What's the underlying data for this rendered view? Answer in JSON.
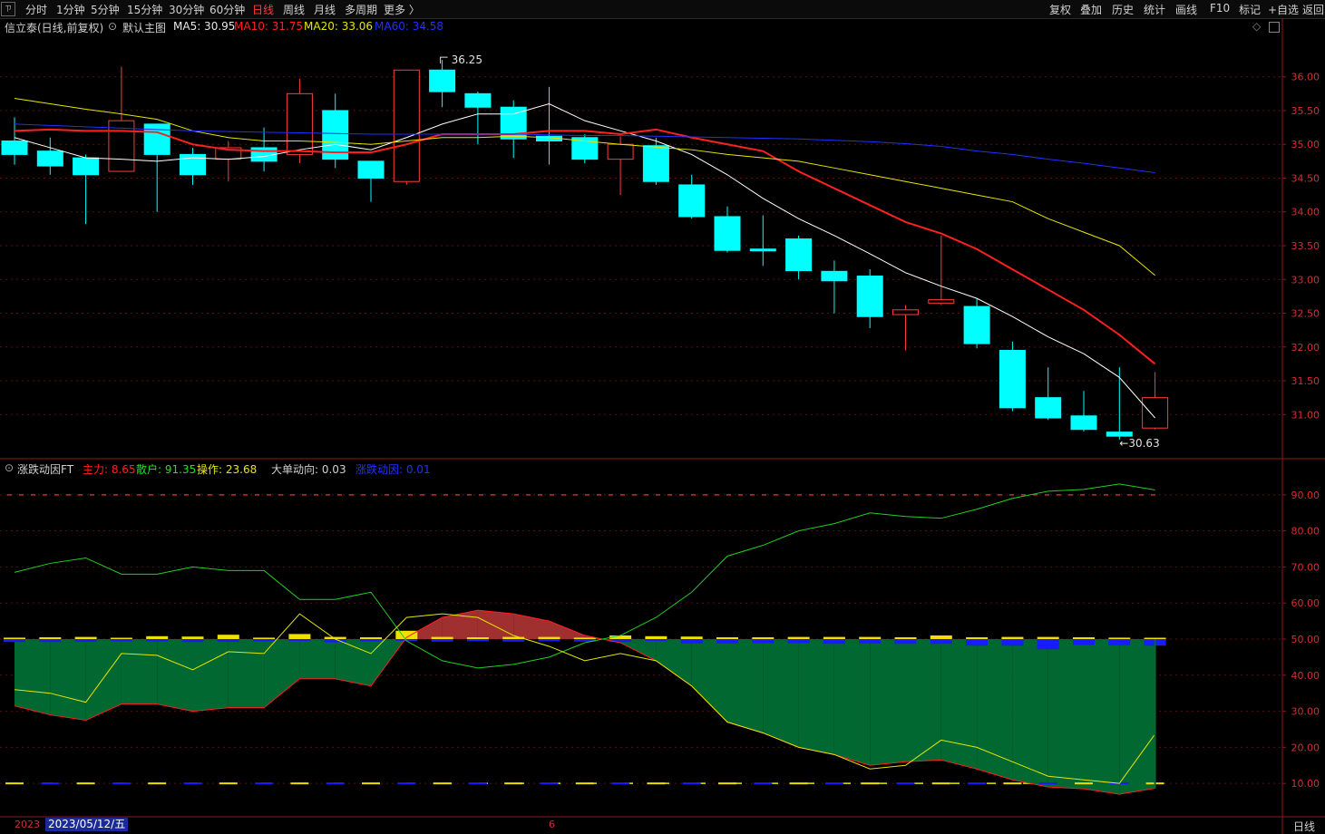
{
  "toolbar": {
    "logo": "ㄗ",
    "periods": [
      "分时",
      "1分钟",
      "5分钟",
      "15分钟",
      "30分钟",
      "60分钟",
      "日线",
      "周线",
      "月线",
      "多周期",
      "更多 〉"
    ],
    "active_period": "日线",
    "right_buttons": [
      "复权",
      "叠加",
      "历史",
      "统计",
      "画线",
      "F10",
      "标记",
      "+自选",
      "返回"
    ]
  },
  "main_chart": {
    "stock_name": "信立泰(日线,前复权)",
    "template": "默认主图",
    "ma5_label": "MA5: 30.95",
    "ma10_label": "MA10: 31.75",
    "ma20_label": "MA20: 33.06",
    "ma60_label": "MA60: 34.58",
    "high_marker": "36.25",
    "low_marker": "30.63",
    "colors": {
      "ma5": "#ffffff",
      "ma10": "#ff2020",
      "ma20": "#e6e600",
      "ma60": "#2030ff",
      "up": "#ff3b3b",
      "down": "#00ffff"
    }
  },
  "sub_chart": {
    "indicator_name": "涨跌动因FT",
    "zhuli_label": "主力: 8.65",
    "sanhu_label": "散户: 91.35",
    "caozuo_label": "操作: 23.68",
    "dadan_label": "大单动向: 0.03",
    "zhangdie_label": "涨跌动因: 0.01"
  },
  "footer": {
    "date_prefix": "2023",
    "cursor_date": "2023/05/12/五",
    "month_mark": "6",
    "period": "日线"
  },
  "chart_data": [
    {
      "type": "candlestick",
      "title": "信立泰(日线,前复权)",
      "y_ticks": [
        "36.00",
        "35.50",
        "35.00",
        "34.50",
        "34.00",
        "33.50",
        "33.00",
        "32.50",
        "32.00",
        "31.50",
        "31.00"
      ],
      "ylim": [
        30.4,
        36.6
      ],
      "candles": [
        {
          "o": 35.05,
          "c": 34.85,
          "h": 35.4,
          "l": 34.7
        },
        {
          "o": 34.9,
          "c": 34.68,
          "h": 35.1,
          "l": 34.55
        },
        {
          "o": 34.8,
          "c": 34.55,
          "h": 34.85,
          "l": 33.82
        },
        {
          "o": 34.6,
          "c": 35.35,
          "h": 36.15,
          "l": 34.6
        },
        {
          "o": 35.3,
          "c": 34.85,
          "h": 35.3,
          "l": 34.0
        },
        {
          "o": 34.85,
          "c": 34.55,
          "h": 34.95,
          "l": 34.4
        },
        {
          "o": 34.78,
          "c": 34.95,
          "h": 35.05,
          "l": 34.45
        },
        {
          "o": 34.95,
          "c": 34.75,
          "h": 35.25,
          "l": 34.6
        },
        {
          "o": 34.85,
          "c": 35.75,
          "h": 35.97,
          "l": 34.72
        },
        {
          "o": 35.5,
          "c": 34.78,
          "h": 35.75,
          "l": 34.65
        },
        {
          "o": 34.75,
          "c": 34.5,
          "h": 34.75,
          "l": 34.15
        },
        {
          "o": 34.45,
          "c": 36.1,
          "h": 36.1,
          "l": 34.4
        },
        {
          "o": 36.1,
          "c": 35.78,
          "h": 36.25,
          "l": 35.55
        },
        {
          "o": 35.75,
          "c": 35.55,
          "h": 35.78,
          "l": 35.0
        },
        {
          "o": 35.55,
          "c": 35.08,
          "h": 35.65,
          "l": 34.8
        },
        {
          "o": 35.12,
          "c": 35.05,
          "h": 35.85,
          "l": 34.7
        },
        {
          "o": 35.1,
          "c": 34.78,
          "h": 35.15,
          "l": 34.72
        },
        {
          "o": 34.78,
          "c": 35.0,
          "h": 35.12,
          "l": 34.25
        },
        {
          "o": 34.98,
          "c": 34.45,
          "h": 35.1,
          "l": 34.4
        },
        {
          "o": 34.4,
          "c": 33.93,
          "h": 34.55,
          "l": 33.9
        },
        {
          "o": 33.93,
          "c": 33.43,
          "h": 34.08,
          "l": 33.4
        },
        {
          "o": 33.45,
          "c": 33.43,
          "h": 33.95,
          "l": 33.2
        },
        {
          "o": 33.6,
          "c": 33.13,
          "h": 33.65,
          "l": 33.0
        },
        {
          "o": 33.12,
          "c": 32.98,
          "h": 33.28,
          "l": 32.5
        },
        {
          "o": 33.05,
          "c": 32.45,
          "h": 33.15,
          "l": 32.28
        },
        {
          "o": 32.48,
          "c": 32.55,
          "h": 32.62,
          "l": 31.95
        },
        {
          "o": 32.65,
          "c": 32.7,
          "h": 33.65,
          "l": 32.62
        },
        {
          "o": 32.6,
          "c": 32.05,
          "h": 32.72,
          "l": 31.98
        },
        {
          "o": 31.95,
          "c": 31.1,
          "h": 32.08,
          "l": 31.05
        },
        {
          "o": 31.25,
          "c": 30.95,
          "h": 31.7,
          "l": 30.92
        },
        {
          "o": 30.98,
          "c": 30.78,
          "h": 31.35,
          "l": 30.75
        },
        {
          "o": 30.74,
          "c": 30.68,
          "h": 31.7,
          "l": 30.63
        },
        {
          "o": 30.8,
          "c": 31.25,
          "h": 31.63,
          "l": 30.78
        }
      ],
      "ma5": [
        35.1,
        34.95,
        34.8,
        34.78,
        34.75,
        34.8,
        34.78,
        34.82,
        34.92,
        35.0,
        34.92,
        35.1,
        35.3,
        35.45,
        35.45,
        35.6,
        35.35,
        35.2,
        35.05,
        34.85,
        34.55,
        34.2,
        33.9,
        33.65,
        33.38,
        33.1,
        32.9,
        32.72,
        32.45,
        32.15,
        31.9,
        31.55,
        30.95
      ],
      "ma10": [
        35.2,
        35.22,
        35.2,
        35.2,
        35.18,
        35.0,
        34.92,
        34.9,
        34.9,
        34.88,
        34.88,
        35.0,
        35.15,
        35.15,
        35.15,
        35.2,
        35.2,
        35.15,
        35.22,
        35.1,
        35.0,
        34.9,
        34.6,
        34.35,
        34.1,
        33.85,
        33.68,
        33.45,
        33.15,
        32.85,
        32.55,
        32.18,
        31.75
      ],
      "ma20": [
        35.68,
        35.6,
        35.52,
        35.45,
        35.37,
        35.2,
        35.1,
        35.05,
        35.05,
        35.03,
        35.0,
        35.05,
        35.1,
        35.1,
        35.12,
        35.1,
        35.05,
        35.0,
        34.96,
        34.92,
        34.85,
        34.8,
        34.75,
        34.65,
        34.55,
        34.45,
        34.35,
        34.25,
        34.15,
        33.9,
        33.7,
        33.5,
        33.06
      ],
      "ma60": [
        35.3,
        35.28,
        35.26,
        35.24,
        35.22,
        35.2,
        35.19,
        35.18,
        35.17,
        35.16,
        35.15,
        35.15,
        35.15,
        35.15,
        35.15,
        35.14,
        35.13,
        35.13,
        35.12,
        35.11,
        35.1,
        35.09,
        35.08,
        35.06,
        35.04,
        35.01,
        34.97,
        34.9,
        34.85,
        34.78,
        34.72,
        34.65,
        34.58
      ]
    },
    {
      "type": "line",
      "title": "涨跌动因FT",
      "y_ticks": [
        "90.00",
        "80.00",
        "70.00",
        "60.00",
        "50.00",
        "40.00",
        "30.00",
        "20.00",
        "10.00"
      ],
      "ylim": [
        1,
        99
      ],
      "series": [
        {
          "name": "主力",
          "values": [
            31.5,
            29,
            27.5,
            32,
            32,
            30,
            31,
            31,
            39,
            39,
            37,
            50.5,
            56,
            58,
            57,
            55,
            51,
            49,
            44,
            37,
            27,
            24,
            20,
            18,
            15,
            16,
            16.5,
            14,
            11,
            9,
            8.5,
            7,
            8.65
          ]
        },
        {
          "name": "散户",
          "values": [
            68.5,
            71,
            72.5,
            68,
            68,
            70,
            69,
            69,
            61,
            61,
            63,
            49.5,
            44,
            42,
            43,
            45,
            49,
            51,
            56,
            63,
            73,
            76,
            80,
            82,
            85,
            84,
            83.5,
            86,
            89,
            91,
            91.5,
            93,
            91.35
          ]
        },
        {
          "name": "操作",
          "values": [
            36,
            35,
            32.5,
            46,
            45.5,
            41.5,
            46.5,
            46,
            57,
            50,
            46,
            56,
            57,
            56,
            51,
            48,
            44,
            46,
            44,
            37,
            27,
            24,
            20,
            18,
            14,
            15,
            22,
            20,
            16,
            12,
            11,
            10,
            23.68
          ]
        }
      ],
      "dadan_bars": [
        0.4,
        0.5,
        0.6,
        0.3,
        0.8,
        0.7,
        1.2,
        0.4,
        1.4,
        0.6,
        0.5,
        2.3,
        0.6,
        0.5,
        0.6,
        0.6,
        0.4,
        1.0,
        0.8,
        0.7,
        0.5,
        0.5,
        0.6,
        0.6,
        0.6,
        0.5,
        1.0,
        0.5,
        0.6,
        0.6,
        0.5,
        0.4,
        0.03
      ],
      "zhangdie_bars": [
        -0.8,
        -0.8,
        -0.7,
        -0.6,
        -0.6,
        -0.8,
        -0.7,
        -0.6,
        -0.5,
        -0.9,
        -0.6,
        -0.5,
        -0.7,
        -0.6,
        -0.7,
        -0.6,
        -0.7,
        -0.8,
        -0.5,
        -1.2,
        -1.2,
        -1.1,
        -1.1,
        -1.3,
        -1.2,
        -1.3,
        -1.3,
        -1.8,
        -1.8,
        -2.8,
        -1.6,
        -1.7,
        -1.8
      ]
    }
  ]
}
